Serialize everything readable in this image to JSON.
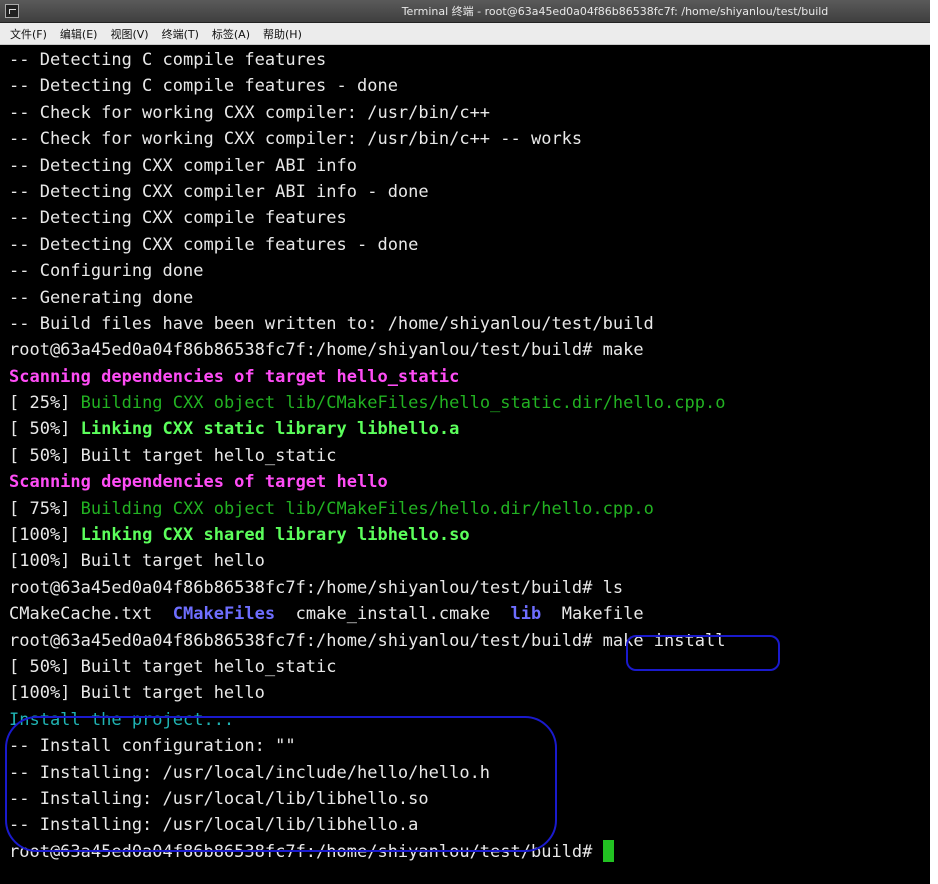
{
  "window": {
    "title": "Terminal 终端 - root@63a45ed0a04f86b86538fc7f: /home/shiyanlou/test/build"
  },
  "menu": [
    "文件(F)",
    "编辑(E)",
    "视图(V)",
    "终端(T)",
    "标签(A)",
    "帮助(H)"
  ],
  "terminal": {
    "lines": [
      [
        {
          "t": "-- Detecting C compile features"
        }
      ],
      [
        {
          "t": "-- Detecting C compile features - done"
        }
      ],
      [
        {
          "t": "-- Check for working CXX compiler: /usr/bin/c++"
        }
      ],
      [
        {
          "t": "-- Check for working CXX compiler: /usr/bin/c++ -- works"
        }
      ],
      [
        {
          "t": "-- Detecting CXX compiler ABI info"
        }
      ],
      [
        {
          "t": "-- Detecting CXX compiler ABI info - done"
        }
      ],
      [
        {
          "t": "-- Detecting CXX compile features"
        }
      ],
      [
        {
          "t": "-- Detecting CXX compile features - done"
        }
      ],
      [
        {
          "t": "-- Configuring done"
        }
      ],
      [
        {
          "t": "-- Generating done"
        }
      ],
      [
        {
          "t": "-- Build files have been written to: /home/shiyanlou/test/build"
        }
      ],
      [
        {
          "t": "root@63a45ed0a04f86b86538fc7f:/home/shiyanlou/test/build# make"
        }
      ],
      [
        {
          "t": "Scanning dependencies of target hello_static",
          "c": "magenta"
        }
      ],
      [
        {
          "t": "[ 25%] "
        },
        {
          "t": "Building CXX object lib/CMakeFiles/hello_static.dir/hello.cpp.o",
          "c": "green"
        }
      ],
      [
        {
          "t": "[ 50%] "
        },
        {
          "t": "Linking CXX static library libhello.a",
          "c": "bgreen"
        }
      ],
      [
        {
          "t": "[ 50%] Built target hello_static"
        }
      ],
      [
        {
          "t": "Scanning dependencies of target hello",
          "c": "magenta"
        }
      ],
      [
        {
          "t": "[ 75%] "
        },
        {
          "t": "Building CXX object lib/CMakeFiles/hello.dir/hello.cpp.o",
          "c": "green"
        }
      ],
      [
        {
          "t": "[100%] "
        },
        {
          "t": "Linking CXX shared library libhello.so",
          "c": "bgreen"
        }
      ],
      [
        {
          "t": "[100%] Built target hello"
        }
      ],
      [
        {
          "t": "root@63a45ed0a04f86b86538fc7f:/home/shiyanlou/test/build# ls"
        }
      ],
      [
        {
          "t": "CMakeCache.txt  "
        },
        {
          "t": "CMakeFiles",
          "c": "blue"
        },
        {
          "t": "  cmake_install.cmake  "
        },
        {
          "t": "lib",
          "c": "blue"
        },
        {
          "t": "  Makefile"
        }
      ],
      [
        {
          "t": "root@63a45ed0a04f86b86538fc7f:/home/shiyanlou/test/build# make install"
        }
      ],
      [
        {
          "t": "[ 50%] Built target hello_static"
        }
      ],
      [
        {
          "t": "[100%] Built target hello"
        }
      ],
      [
        {
          "t": "Install the project...",
          "c": "cyan"
        }
      ],
      [
        {
          "t": "-- Install configuration: \"\""
        }
      ],
      [
        {
          "t": "-- Installing: /usr/local/include/hello/hello.h"
        }
      ],
      [
        {
          "t": "-- Installing: /usr/local/lib/libhello.so"
        }
      ],
      [
        {
          "t": "-- Installing: /usr/local/lib/libhello.a"
        }
      ]
    ],
    "prompt": "root@63a45ed0a04f86b86538fc7f:/home/shiyanlou/test/build# "
  },
  "colors": {
    "magenta": "#ff4df6",
    "green": "#22b222",
    "bright_green": "#5cff5c",
    "blue": "#6e6eff",
    "cyan": "#1fb3b3",
    "annotation": "#1a1acc"
  }
}
